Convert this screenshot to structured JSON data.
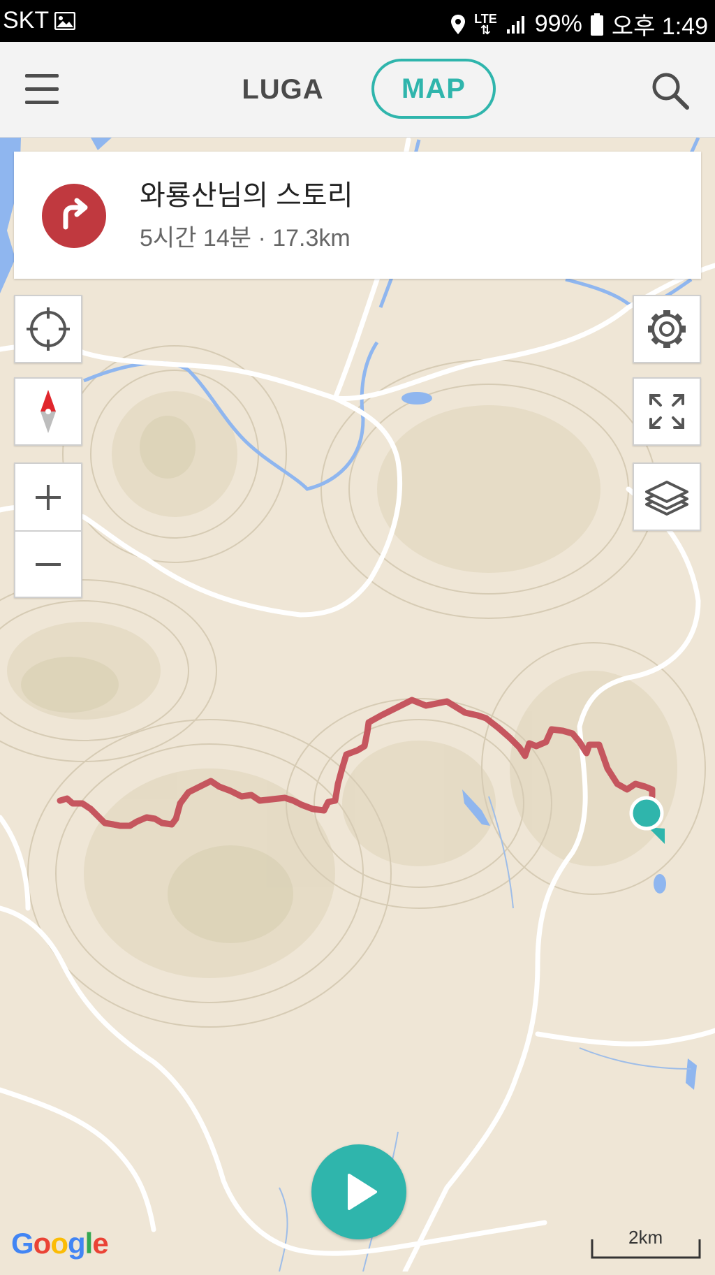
{
  "status_bar": {
    "carrier": "SKT",
    "network": "LTE",
    "battery": "99%",
    "time": "오후 1:49",
    "icons": [
      "image-icon",
      "location-icon",
      "lte-icon",
      "signal-icon",
      "battery-icon"
    ]
  },
  "app_bar": {
    "tabs": [
      {
        "label": "LUGA",
        "active": false
      },
      {
        "label": "MAP",
        "active": true
      }
    ],
    "icons": [
      "menu-icon",
      "search-icon"
    ]
  },
  "story_card": {
    "title": "와룡산님의 스토리",
    "subtitle": "5시간 14분 · 17.3km",
    "icon": "turn-right-arrow-icon",
    "icon_color": "#c0393f"
  },
  "map_controls": {
    "left": [
      "my-location-icon",
      "compass-icon",
      "zoom-in-icon",
      "zoom-out-icon"
    ],
    "right": [
      "settings-icon",
      "fullscreen-icon",
      "layers-icon"
    ]
  },
  "play_button": {
    "icon": "play-icon",
    "color": "#2fb5ac"
  },
  "attribution": {
    "logo": "Google"
  },
  "scale": {
    "label": "2km"
  },
  "colors": {
    "accent": "#2fb5ac",
    "route": "#c24a55",
    "terrain": "#efe6d6",
    "water": "#8fb6ef"
  }
}
